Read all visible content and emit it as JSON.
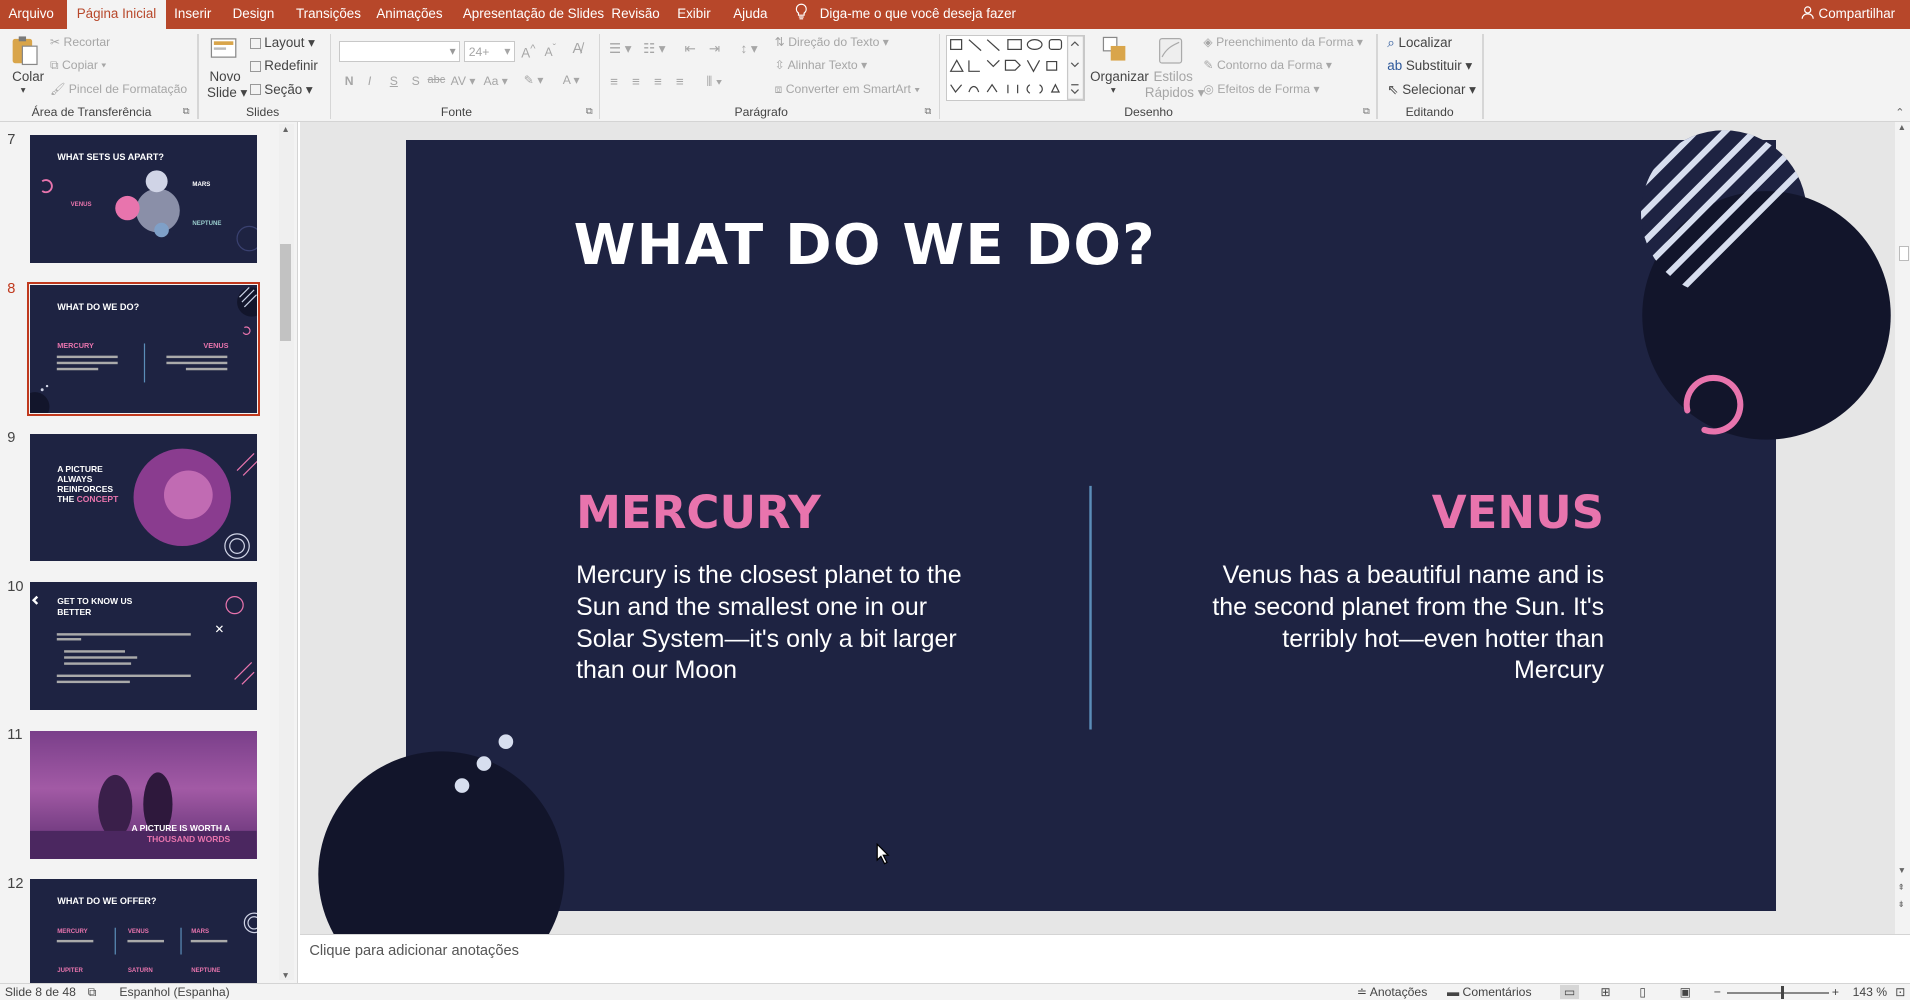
{
  "tabs": [
    "Arquivo",
    "Página Inicial",
    "Inserir",
    "Design",
    "Transições",
    "Animações",
    "Apresentação de Slides",
    "Revisão",
    "Exibir",
    "Ajuda"
  ],
  "tell_me": "Diga-me o que você deseja fazer",
  "share": "Compartilhar",
  "ribbon": {
    "clipboard": {
      "paste": "Colar",
      "cut": "Recortar",
      "copy": "Copiar",
      "painter": "Pincel de Formatação",
      "label": "Área de Transferência"
    },
    "slides": {
      "new": "Novo",
      "new2": "Slide",
      "layout": "Layout",
      "reset": "Redefinir",
      "section": "Seção",
      "label": "Slides"
    },
    "font": {
      "label": "Fonte",
      "size": "24+",
      "bold": "N",
      "italic": "I",
      "underline": "S",
      "shadow": "S",
      "strike": "abc",
      "spacing": "AV",
      "case": "Aa"
    },
    "paragraph": {
      "text_dir": "Direção do Texto",
      "align_text": "Alinhar Texto",
      "smartart": "Converter em SmartArt",
      "label": "Parágrafo"
    },
    "drawing": {
      "arrange": "Organizar",
      "styles": "Estilos",
      "styles2": "Rápidos",
      "fill": "Preenchimento da Forma",
      "outline": "Contorno da Forma",
      "effects": "Efeitos de Forma",
      "label": "Desenho"
    },
    "editing": {
      "find": "Localizar",
      "replace": "Substituir",
      "select": "Selecionar",
      "label": "Editando"
    }
  },
  "thumbs": [
    {
      "num": "7",
      "title": "WHAT SETS US APART?",
      "a": "VENUS",
      "b": "MARS",
      "c": "NEPTUNE"
    },
    {
      "num": "8",
      "title": "WHAT DO WE DO?",
      "a": "MERCURY",
      "b": "VENUS"
    },
    {
      "num": "9",
      "t1": "A PICTURE",
      "t2": "ALWAYS",
      "t3": "REINFORCES",
      "t4": "THE",
      "t5": "CONCEPT"
    },
    {
      "num": "10",
      "t1": "GET TO KNOW US",
      "t2": "BETTER"
    },
    {
      "num": "11",
      "t1": "A PICTURE IS WORTH A",
      "t2": "THOUSAND WORDS"
    },
    {
      "num": "12",
      "title": "WHAT DO WE OFFER?",
      "a": "MERCURY",
      "b": "VENUS",
      "c": "MARS",
      "d": "JUPITER",
      "e": "SATURN",
      "f": "NEPTUNE"
    }
  ],
  "slide": {
    "title": "WHAT DO WE DO?",
    "left_heading": "MERCURY",
    "left_body": "Mercury is the closest planet to the Sun and the smallest one in our Solar System—it's only a bit larger than our Moon",
    "right_heading": "VENUS",
    "right_body": "Venus has a beautiful name and is the second planet from the Sun. It's terribly hot—even hotter than Mercury"
  },
  "notes_placeholder": "Clique para adicionar anotações",
  "status": {
    "slide_count": "Slide 8 de 48",
    "language": "Espanhol (Espanha)",
    "notes": "Anotações",
    "comments": "Comentários",
    "zoom": "143 %"
  },
  "colors": {
    "accent": "#b7472a",
    "slide_bg": "#1e2342",
    "pink": "#e874ad",
    "line": "#5b8db8"
  }
}
